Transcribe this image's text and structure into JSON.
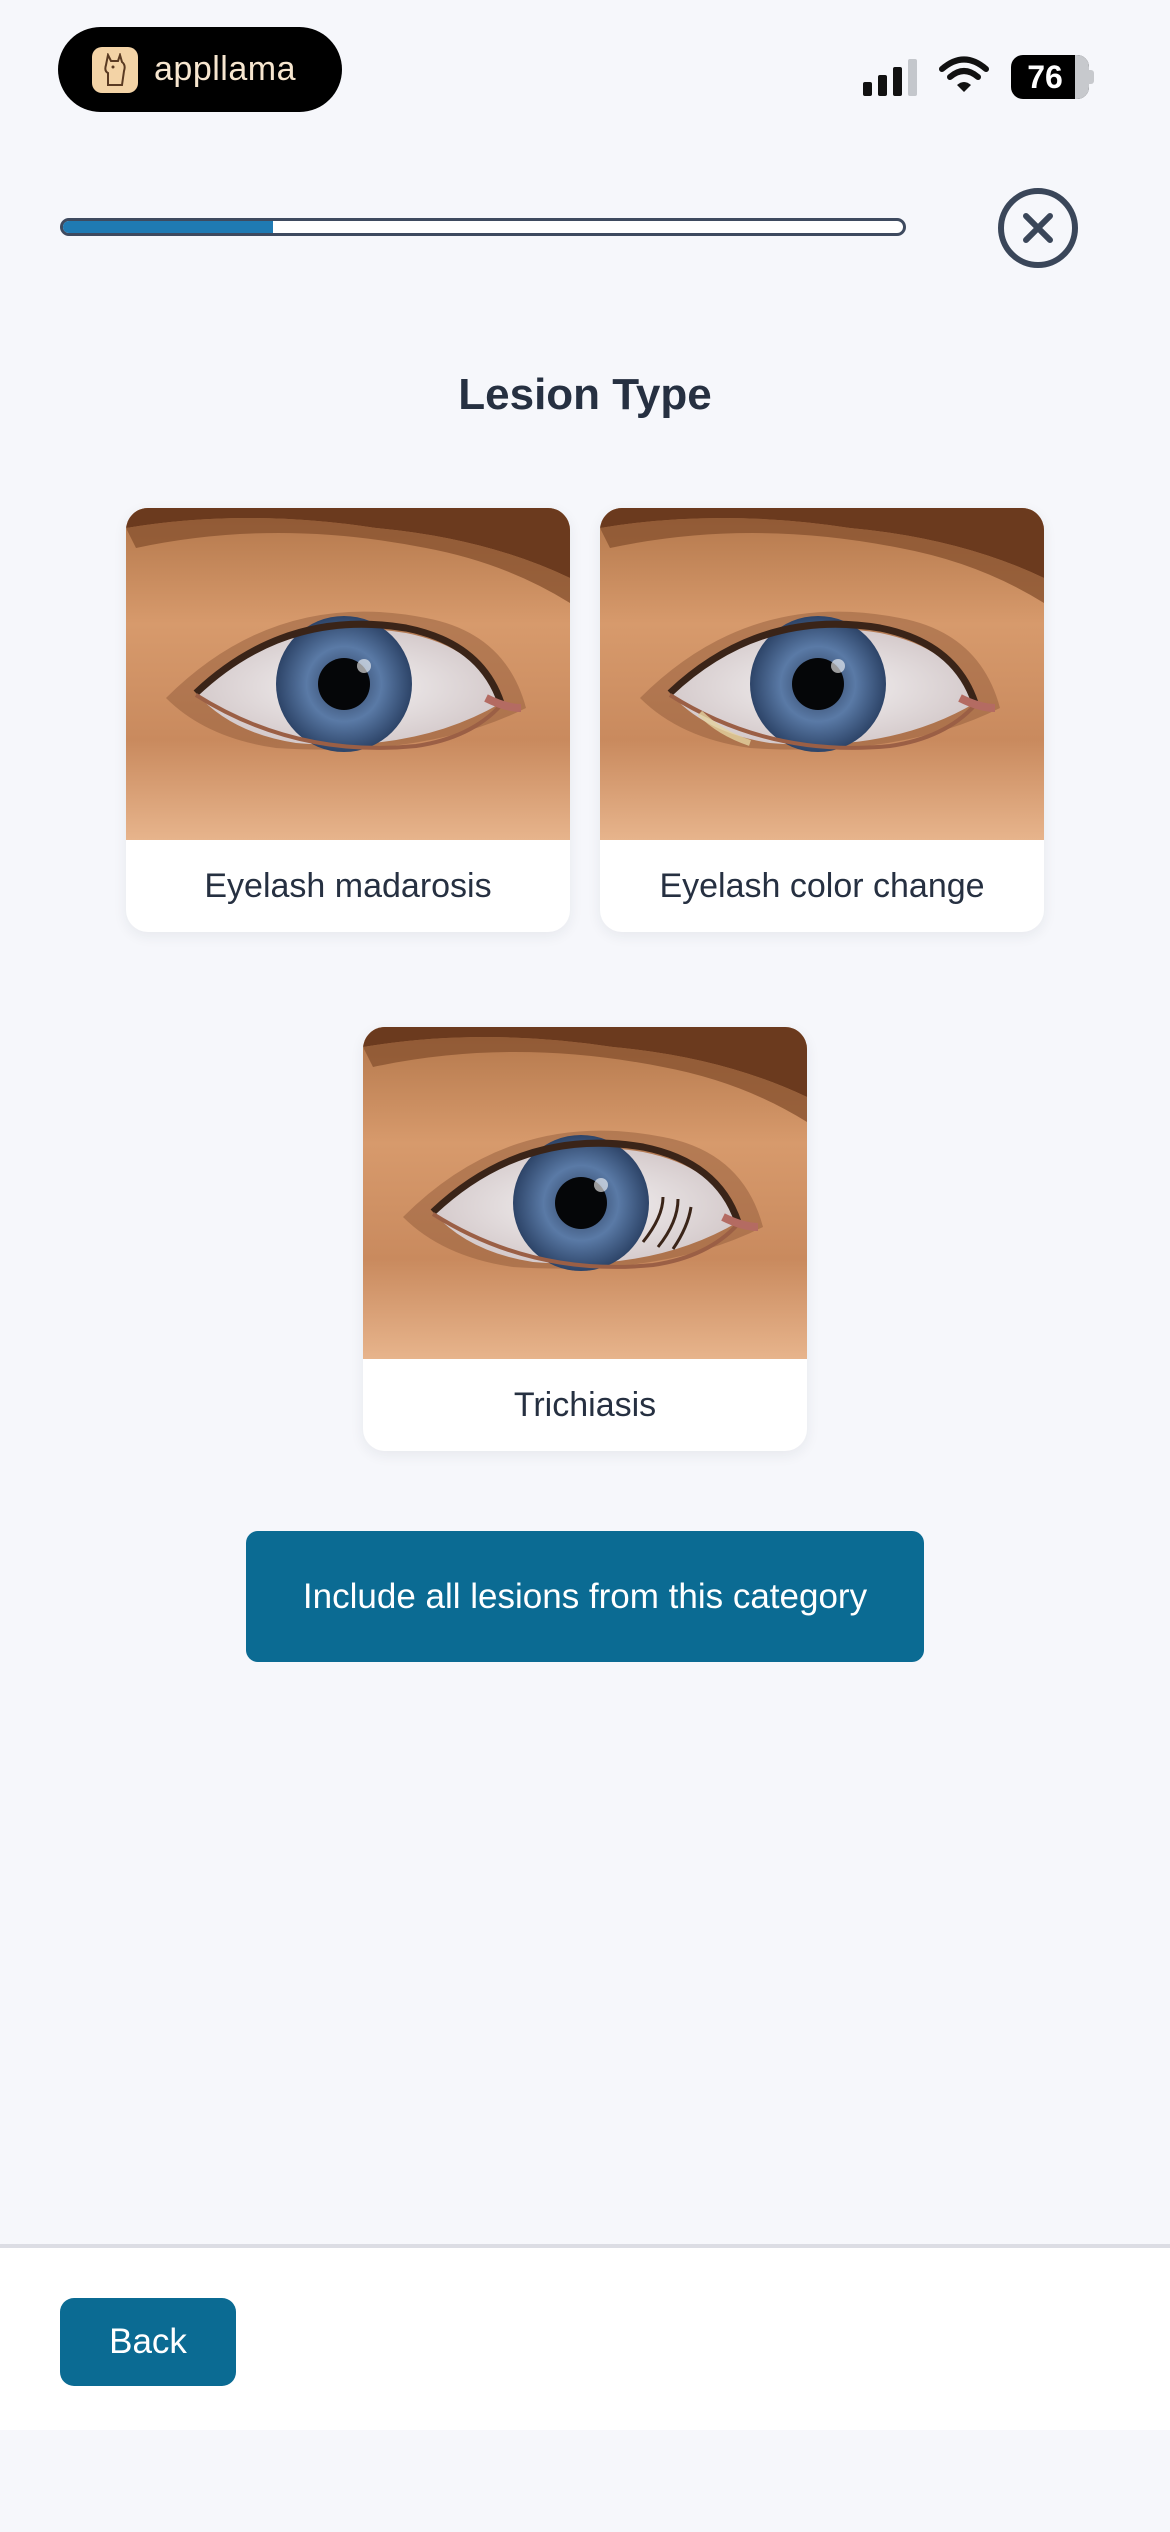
{
  "status_bar": {
    "brand_name": "appllama",
    "battery_level": "76",
    "icons": [
      "llama-logo-icon",
      "cellular-signal-icon",
      "wifi-icon",
      "battery-icon"
    ]
  },
  "progress": {
    "fraction": 0.25
  },
  "header": {
    "close_icon": "close-circle-icon"
  },
  "page": {
    "title": "Lesion Type"
  },
  "options": [
    {
      "label": "Eyelash madarosis"
    },
    {
      "label": "Eyelash color change"
    },
    {
      "label": "Trichiasis"
    }
  ],
  "actions": {
    "include_all_label": "Include all lesions from this category",
    "back_label": "Back"
  },
  "colors": {
    "background": "#f6f7fb",
    "accent": "#0b6b93",
    "progress": "#1f7ab3",
    "text": "#263041"
  }
}
